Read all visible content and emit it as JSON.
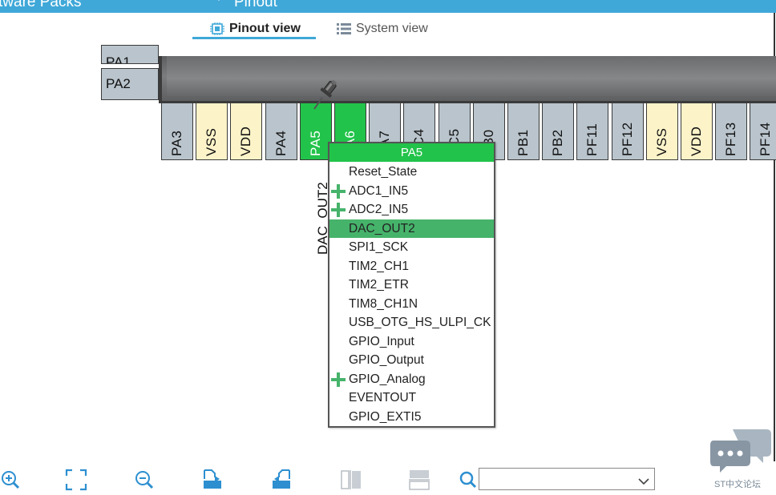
{
  "topbar": {
    "left_menu": "tware Packs",
    "right_menu": "Pinout"
  },
  "tabs": {
    "pinout": "Pinout view",
    "system": "System view"
  },
  "left_pins": [
    {
      "label": "PA1"
    },
    {
      "label": "PA2"
    }
  ],
  "bottom_pins": [
    {
      "label": "PA3",
      "kind": "io"
    },
    {
      "label": "VSS",
      "kind": "power"
    },
    {
      "label": "VDD",
      "kind": "power"
    },
    {
      "label": "PA4",
      "kind": "io"
    },
    {
      "label": "PA5",
      "kind": "active"
    },
    {
      "label": "PA6",
      "kind": "active"
    },
    {
      "label": "PA7",
      "kind": "io"
    },
    {
      "label": "PC4",
      "kind": "io"
    },
    {
      "label": "PC5",
      "kind": "io"
    },
    {
      "label": "PB0",
      "kind": "io"
    },
    {
      "label": "PB1",
      "kind": "io"
    },
    {
      "label": "PB2",
      "kind": "io"
    },
    {
      "label": "PF11",
      "kind": "io"
    },
    {
      "label": "PF12",
      "kind": "io"
    },
    {
      "label": "VSS",
      "kind": "power"
    },
    {
      "label": "VDD",
      "kind": "power"
    },
    {
      "label": "PF13",
      "kind": "io"
    },
    {
      "label": "PF14",
      "kind": "io"
    }
  ],
  "signal_label": "DAC_OUT2",
  "context_menu": {
    "header": "PA5",
    "items": [
      {
        "label": "Reset_State",
        "plus": false,
        "selected": false
      },
      {
        "label": "ADC1_IN5",
        "plus": true,
        "selected": false
      },
      {
        "label": "ADC2_IN5",
        "plus": true,
        "selected": false
      },
      {
        "label": "DAC_OUT2",
        "plus": false,
        "selected": true
      },
      {
        "label": "SPI1_SCK",
        "plus": false,
        "selected": false
      },
      {
        "label": "TIM2_CH1",
        "plus": false,
        "selected": false
      },
      {
        "label": "TIM2_ETR",
        "plus": false,
        "selected": false
      },
      {
        "label": "TIM8_CH1N",
        "plus": false,
        "selected": false
      },
      {
        "label": "USB_OTG_HS_ULPI_CK",
        "plus": false,
        "selected": false
      },
      {
        "label": "GPIO_Input",
        "plus": false,
        "selected": false
      },
      {
        "label": "GPIO_Output",
        "plus": false,
        "selected": false
      },
      {
        "label": "GPIO_Analog",
        "plus": true,
        "selected": false
      },
      {
        "label": "EVENTOUT",
        "plus": false,
        "selected": false
      },
      {
        "label": "GPIO_EXTI5",
        "plus": false,
        "selected": false
      }
    ]
  },
  "toolbar": {
    "tools": [
      "zoom-in-icon",
      "fit-screen-icon",
      "zoom-out-icon",
      "export-icon",
      "import-icon",
      "split-vertical-icon",
      "split-horizontal-icon",
      "search-icon"
    ],
    "search_value": ""
  },
  "forum": {
    "label": "ST中文论坛"
  },
  "colors": {
    "accent": "#3fa8d8",
    "active_pin": "#22c34a",
    "io_pin": "#b9c4cc",
    "power_pin": "#fcf3c9",
    "selected_item": "#46b36b"
  }
}
